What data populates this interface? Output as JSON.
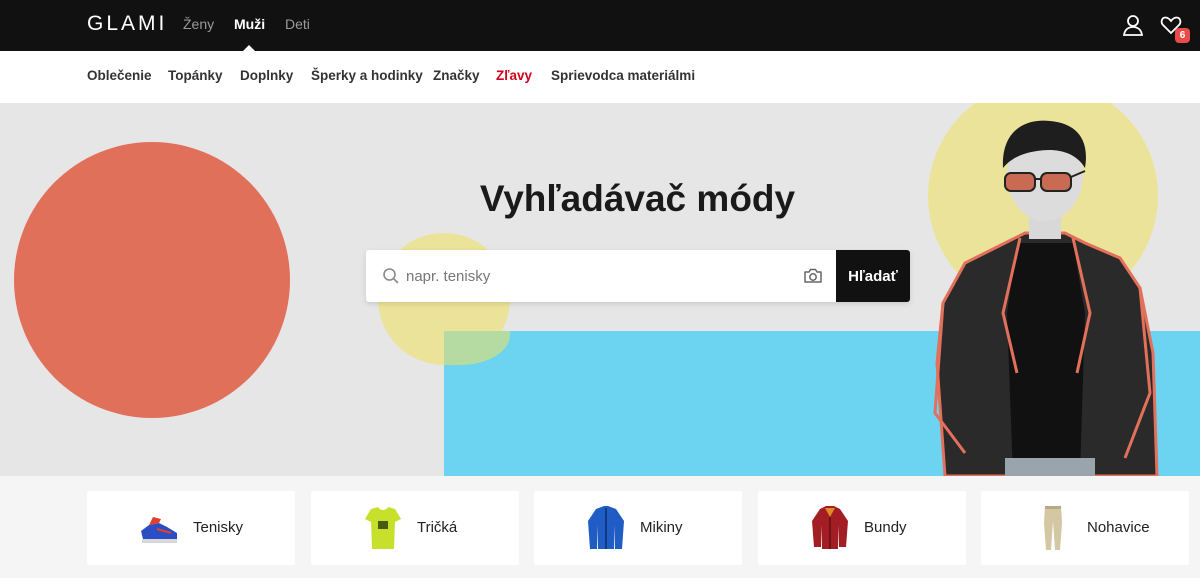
{
  "header": {
    "logo": "GLAMI",
    "genders": [
      "Ženy",
      "Muži",
      "Deti"
    ],
    "active_gender": "Muži",
    "wishlist_count": "6"
  },
  "nav": {
    "categories": [
      "Oblečenie",
      "Topánky",
      "Doplnky",
      "Šperky a hodinky",
      "Značky",
      "Zľavy",
      "Sprievodca materiálmi"
    ]
  },
  "hero": {
    "title": "Vyhľadávač módy",
    "search_placeholder": "napr. tenisky",
    "search_value": "",
    "search_button": "Hľadať"
  },
  "category_cards": [
    {
      "label": "Tenisky",
      "icon": "sneaker-icon"
    },
    {
      "label": "Tričká",
      "icon": "tshirt-icon"
    },
    {
      "label": "Mikiny",
      "icon": "hoodie-icon"
    },
    {
      "label": "Bundy",
      "icon": "jacket-icon"
    },
    {
      "label": "Nohavice",
      "icon": "trousers-icon"
    }
  ],
  "colors": {
    "topbar": "#111111",
    "sale": "#d0021b",
    "accent_red": "#e0705a",
    "accent_yellow": "#ece39a",
    "accent_blue": "#6cd3f0",
    "badge": "#e94b4b"
  }
}
